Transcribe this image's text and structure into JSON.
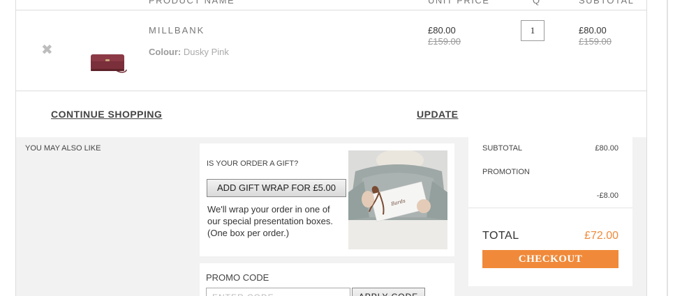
{
  "cart": {
    "headers": {
      "product": "PRODUCT NAME",
      "unit_price": "UNIT PRICE",
      "qty": "Q",
      "subtotal": "SUBTOTAL"
    },
    "item": {
      "remove_icon": "close-icon",
      "name": "MILLBANK",
      "colour_label": "Colour:",
      "colour_value": "Dusky Pink",
      "unit_price": "£80.00",
      "unit_price_was": "£159.00",
      "quantity": "1",
      "subtotal": "£80.00",
      "subtotal_was": "£159.00"
    },
    "continue_shopping": "CONTINUE SHOPPING",
    "update": "UPDATE"
  },
  "may_like": {
    "title": "YOU MAY ALSO LIKE"
  },
  "gift": {
    "question": "IS YOUR ORDER A GIFT?",
    "button": "ADD GIFT WRAP FOR £5.00",
    "description": "We'll wrap your order in one of our special presentation boxes. (One box per order.)"
  },
  "promo": {
    "label": "PROMO CODE",
    "placeholder": "ENTER CODE",
    "apply": "APPLY CODE"
  },
  "summary": {
    "subtotal_label": "SUBTOTAL",
    "subtotal_value": "£80.00",
    "promotion_label": "PROMOTION",
    "promotion_value": "-£8.00",
    "total_label": "TOTAL",
    "total_value": "£72.00",
    "checkout": "CHECKOUT"
  },
  "colors": {
    "accent": "#f08a3a",
    "panel": "#f2f2f2",
    "product": "#6e2a33"
  }
}
